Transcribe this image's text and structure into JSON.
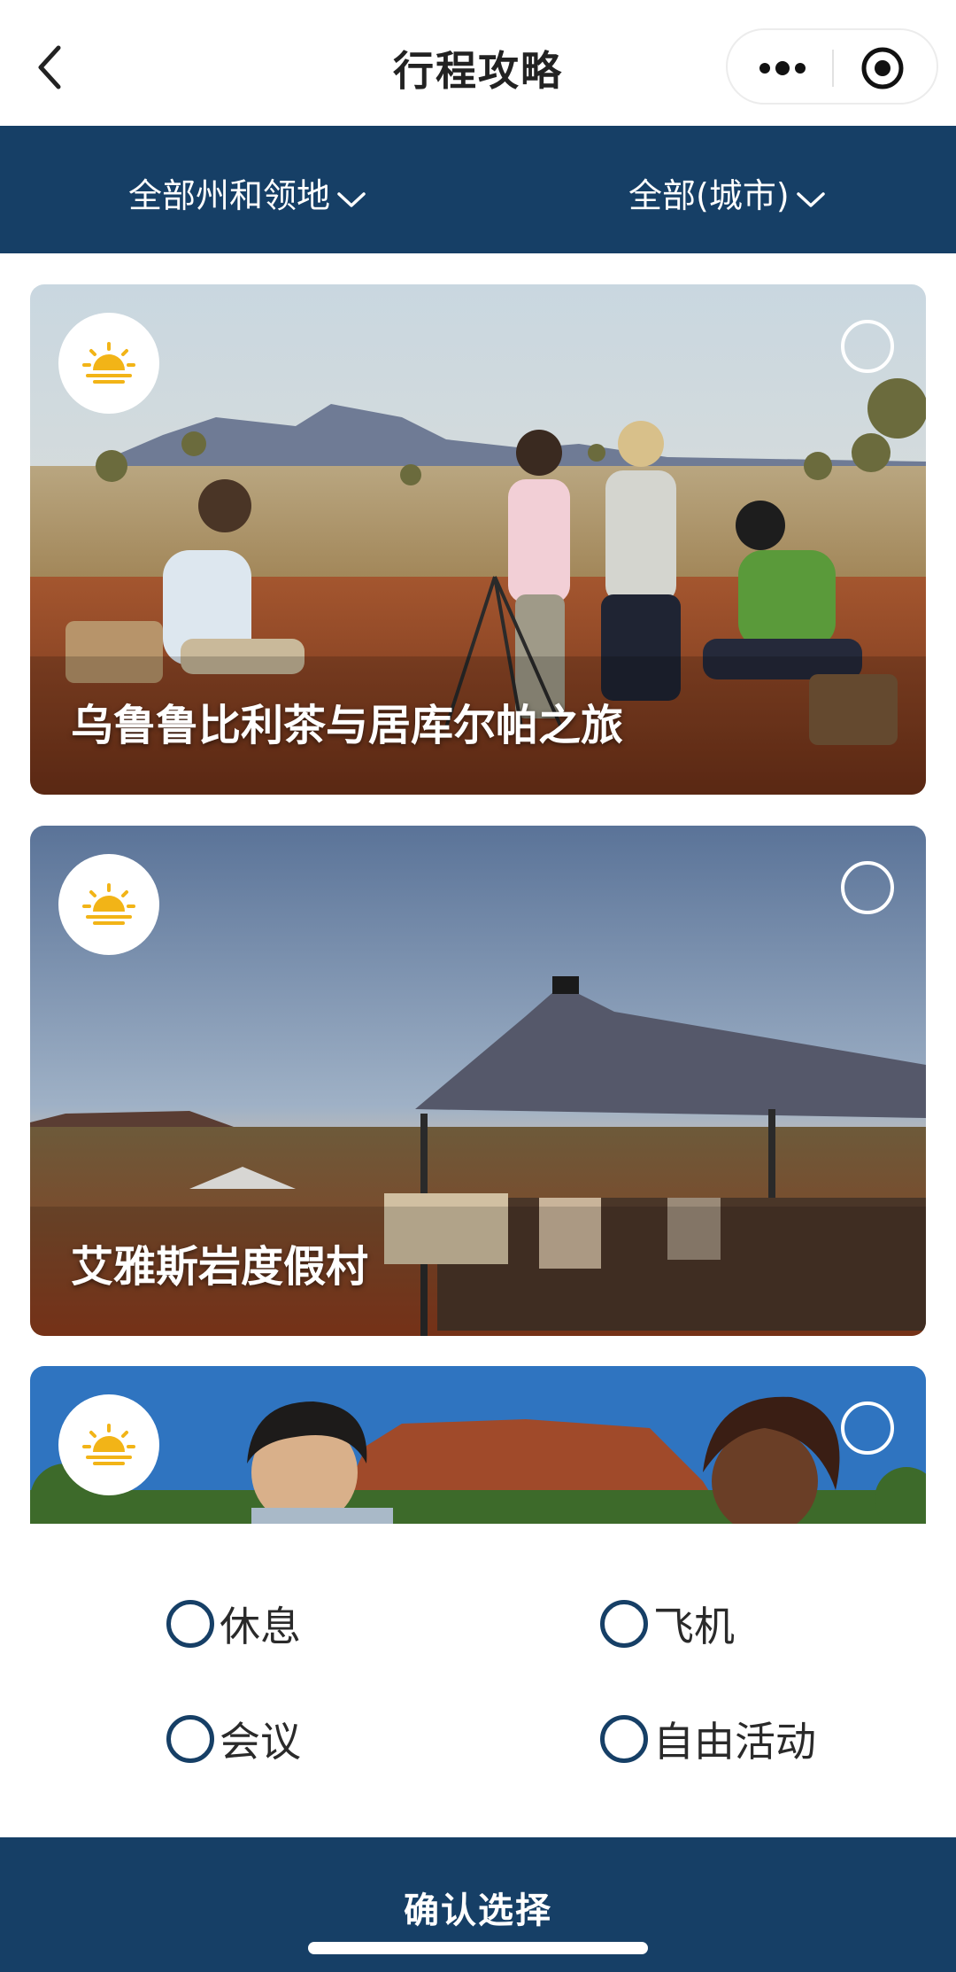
{
  "navbar": {
    "title": "行程攻略",
    "icons": {
      "back": "chevron-left-icon",
      "more": "more-dots-icon",
      "close": "target-circle-icon"
    }
  },
  "filters": {
    "region_label": "全部州和领地",
    "city_label": "全部(城市)"
  },
  "cards": [
    {
      "title": "乌鲁鲁比利茶与居库尔帕之旅",
      "icon": "sunrise-icon",
      "selected": false
    },
    {
      "title": "艾雅斯岩度假村",
      "icon": "sunrise-icon",
      "selected": false
    },
    {
      "title": "",
      "icon": "sunrise-icon",
      "selected": false
    }
  ],
  "type_options": [
    {
      "label": "休息",
      "selected": false
    },
    {
      "label": "飞机",
      "selected": false
    },
    {
      "label": "会议",
      "selected": false
    },
    {
      "label": "自由活动",
      "selected": false
    }
  ],
  "confirm": {
    "label": "确认选择"
  },
  "colors": {
    "primary": "#163f66",
    "sun": "#f2b417"
  }
}
